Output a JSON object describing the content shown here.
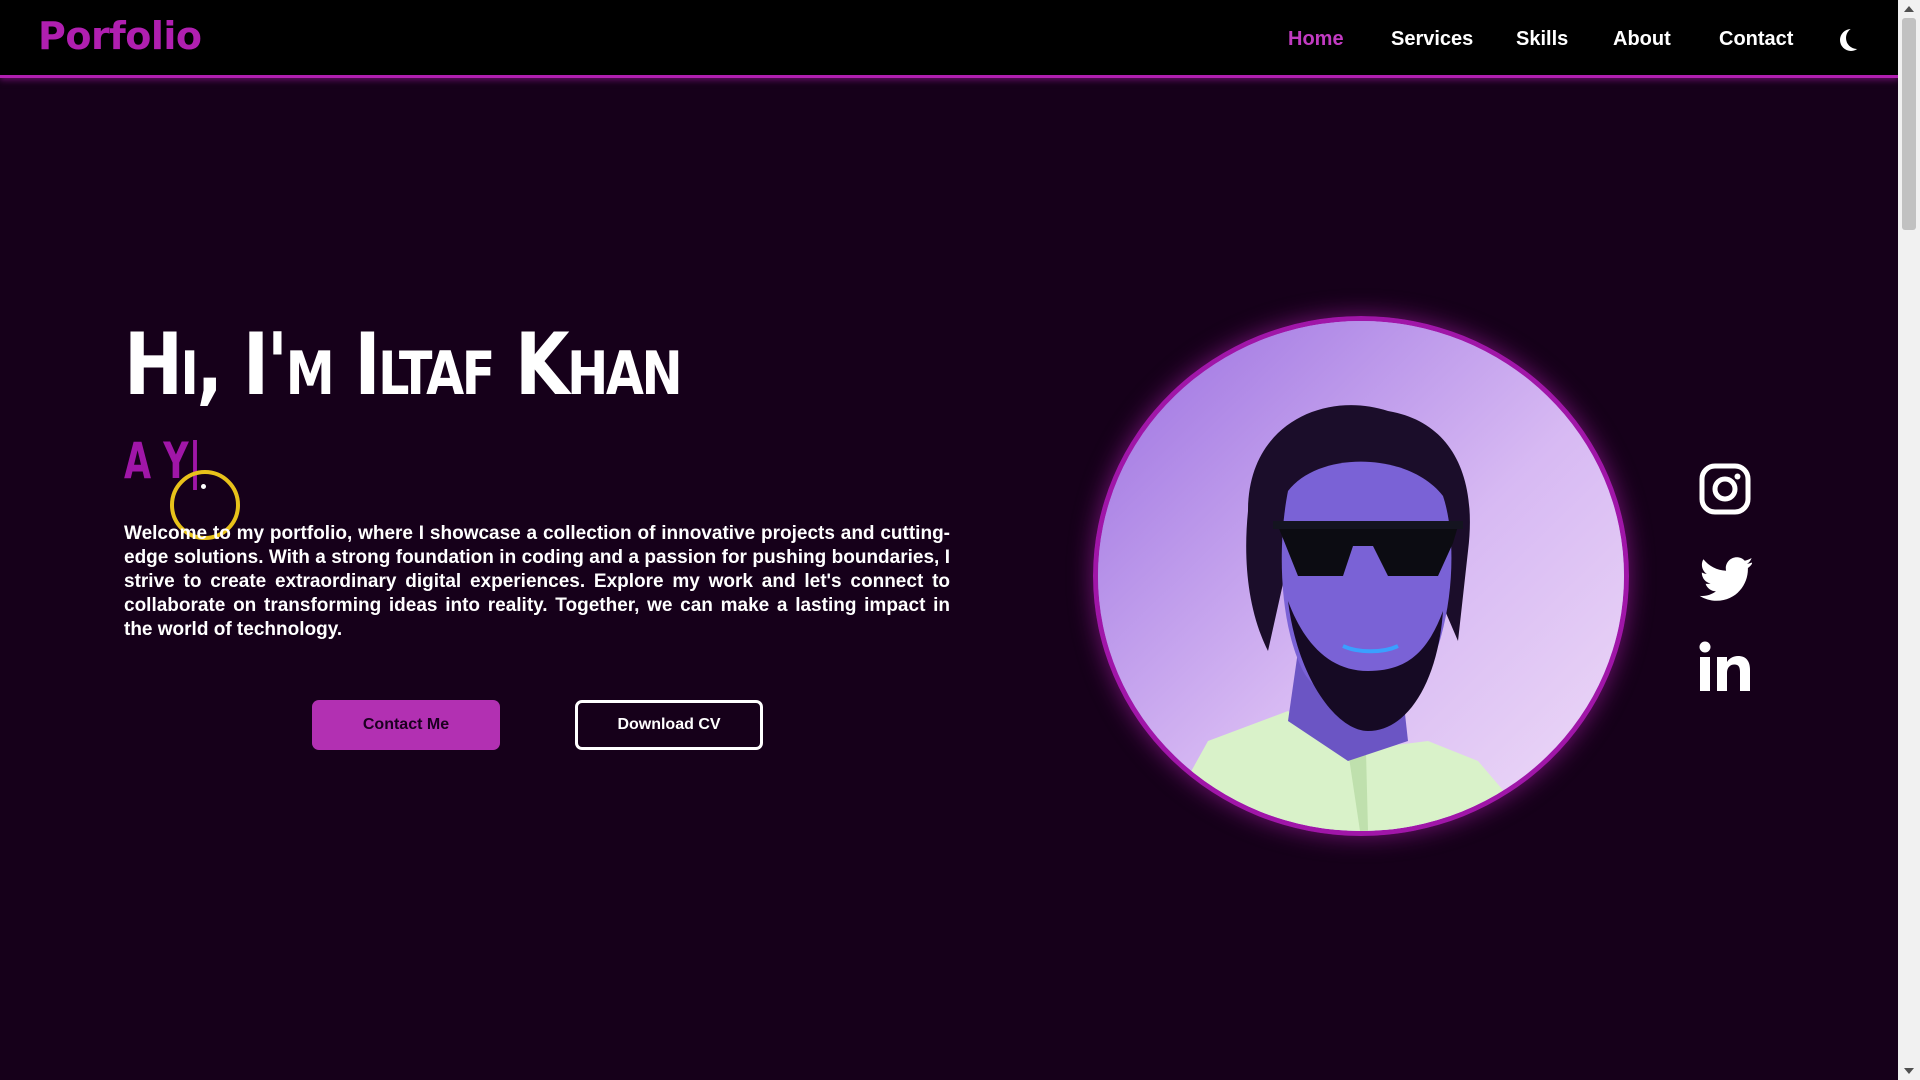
{
  "logo": "Porfolio",
  "nav": {
    "items": [
      {
        "label": "Home",
        "active": true
      },
      {
        "label": "Services",
        "active": false
      },
      {
        "label": "Skills",
        "active": false
      },
      {
        "label": "About",
        "active": false
      },
      {
        "label": "Contact",
        "active": false
      }
    ],
    "theme_toggle_icon": "moon-icon"
  },
  "hero": {
    "title": "Hi, I'm Iltaf Khan",
    "typed_text": "A Y|",
    "intro": "Welcome to my portfolio, where I showcase a collection of innovative projects and cutting-edge solutions. With a strong foundation in coding and a passion for pushing boundaries, I strive to create extraordinary digital experiences. Explore my work and let's connect to collaborate on transforming ideas into reality. Together, we can make a lasting impact in the world of technology.",
    "buttons": {
      "contact": "Contact Me",
      "download": "Download CV"
    }
  },
  "profile": {
    "image_icon": "profile-photo"
  },
  "social": [
    {
      "name": "instagram-icon"
    },
    {
      "name": "twitter-icon"
    },
    {
      "name": "linkedin-icon"
    }
  ],
  "colors": {
    "accent": "#b01fb0",
    "background": "#16001a",
    "navbar": "#000000",
    "active_link": "#c23bc2",
    "cursor_highlight": "#e8c21a"
  }
}
